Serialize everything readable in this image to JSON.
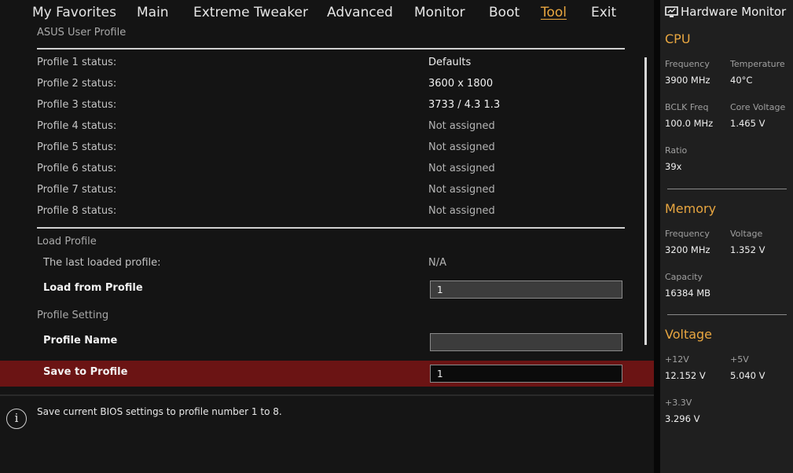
{
  "menu": [
    "My Favorites",
    "Main",
    "Extreme Tweaker",
    "Advanced",
    "Monitor",
    "Boot",
    "Tool",
    "Exit"
  ],
  "active_menu": "Tool",
  "main": {
    "section_user_profile": "ASUS User Profile",
    "profiles": [
      {
        "label": "Profile 1 status:",
        "value": "Defaults"
      },
      {
        "label": "Profile 2 status:",
        "value": "3600 x 1800"
      },
      {
        "label": "Profile 3 status:",
        "value": "3733 / 4.3 1.3"
      },
      {
        "label": "Profile 4 status:",
        "value": "Not assigned"
      },
      {
        "label": "Profile 5 status:",
        "value": "Not assigned"
      },
      {
        "label": "Profile 6 status:",
        "value": "Not assigned"
      },
      {
        "label": "Profile 7 status:",
        "value": "Not assigned"
      },
      {
        "label": "Profile 8 status:",
        "value": "Not assigned"
      }
    ],
    "section_load_profile": "Load Profile",
    "last_loaded_label": "The last loaded profile:",
    "last_loaded_value": "N/A",
    "load_from_label": "Load from Profile",
    "load_from_value": "1",
    "section_profile_setting": "Profile Setting",
    "profile_name_label": "Profile Name",
    "profile_name_value": "",
    "save_to_label": "Save to Profile",
    "save_to_value": "1"
  },
  "help_text": "Save current BIOS settings to profile number 1 to 8.",
  "hw": {
    "title": "Hardware Monitor",
    "cpu": {
      "title": "CPU",
      "frequency_label": "Frequency",
      "frequency": "3900 MHz",
      "temperature_label": "Temperature",
      "temperature": "40°C",
      "bclk_label": "BCLK Freq",
      "bclk": "100.0 MHz",
      "core_voltage_label": "Core Voltage",
      "core_voltage": "1.465 V",
      "ratio_label": "Ratio",
      "ratio": "39x"
    },
    "memory": {
      "title": "Memory",
      "frequency_label": "Frequency",
      "frequency": "3200 MHz",
      "voltage_label": "Voltage",
      "voltage": "1.352 V",
      "capacity_label": "Capacity",
      "capacity": "16384 MB"
    },
    "voltage": {
      "title": "Voltage",
      "v12_label": "+12V",
      "v12": "12.152 V",
      "v5_label": "+5V",
      "v5": "5.040 V",
      "v33_label": "+3.3V",
      "v33": "3.296 V"
    }
  },
  "colors": {
    "accent": "#e8a640",
    "selected_row": "#6b1414"
  }
}
